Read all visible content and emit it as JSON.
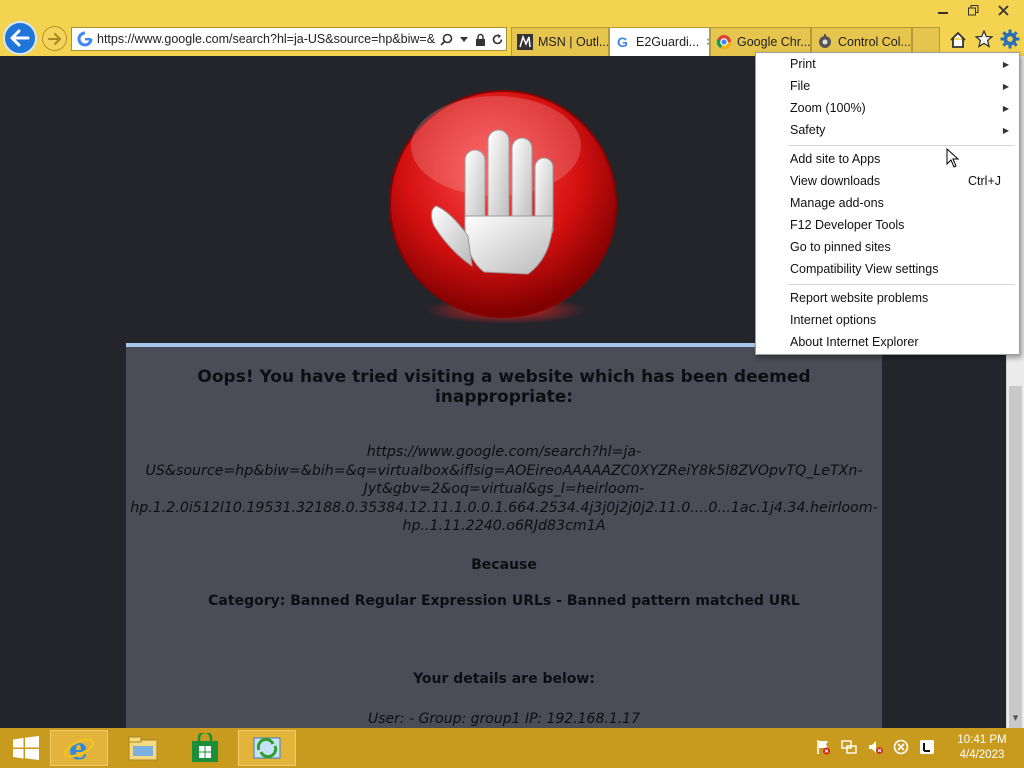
{
  "browser": {
    "address_url": "https://www.google.com/search?hl=ja-US&source=hp&biw=&",
    "tabs": [
      {
        "label": "MSN | Outl...",
        "icon": "msn-icon",
        "active": false
      },
      {
        "label": "E2Guardi...",
        "icon": "google-icon",
        "active": true
      },
      {
        "label": "Google Chr...",
        "icon": "chrome-icon",
        "active": false
      },
      {
        "label": "Control Col...",
        "icon": "control-panel-icon",
        "active": false
      }
    ]
  },
  "page": {
    "headline": "Oops! You have tried visiting a website which has been deemed inappropriate:",
    "blocked_url_lines": [
      "https://www.google.com/search?hl=ja-",
      "US&source=hp&biw=&bih=&q=virtualbox&iflsig=AOEireoAAAAAZC0XYZReiY8k5I8ZVOpvTQ_LeTXn-",
      "Jyt&gbv=2&oq=virtual&gs_l=heirloom-",
      "hp.1.2.0i512l10.19531.32188.0.35384.12.11.1.0.0.1.664.2534.4j3j0j2j0j2.11.0....0...1ac.1j4.34.heirloom-",
      "hp..1.11.2240.o6RJd83cm1A"
    ],
    "because_label": "Because",
    "category_text": "Category: Banned Regular Expression URLs - Banned pattern matched URL",
    "details_title": "Your details are below:",
    "details_line": "User: -   Group: group1   IP: 192.168.1.17"
  },
  "tools_menu": {
    "items": [
      {
        "label": "Print",
        "submenu": true
      },
      {
        "label": "File",
        "submenu": true
      },
      {
        "label": "Zoom (100%)",
        "submenu": true
      },
      {
        "label": "Safety",
        "submenu": true
      },
      {
        "label": "Add site to Apps"
      },
      {
        "label": "View downloads",
        "shortcut": "Ctrl+J"
      },
      {
        "label": "Manage add-ons"
      },
      {
        "label": "F12 Developer Tools"
      },
      {
        "label": "Go to pinned sites"
      },
      {
        "label": "Compatibility View settings"
      },
      {
        "label": "Report website problems"
      },
      {
        "label": "Internet options"
      },
      {
        "label": "About Internet Explorer"
      }
    ]
  },
  "taskbar": {
    "apps": [
      "internet-explorer-icon",
      "file-explorer-icon",
      "store-icon",
      "virtualbox-icon"
    ],
    "clock_time": "10:41 PM",
    "clock_date": "4/4/2023"
  },
  "colors": {
    "chrome_bg": "#f3d34f",
    "taskbar_bg": "#c89a1e",
    "page_bg": "#23252b",
    "panel_bg": "#4a4d57",
    "category_red": "#d3171b"
  }
}
